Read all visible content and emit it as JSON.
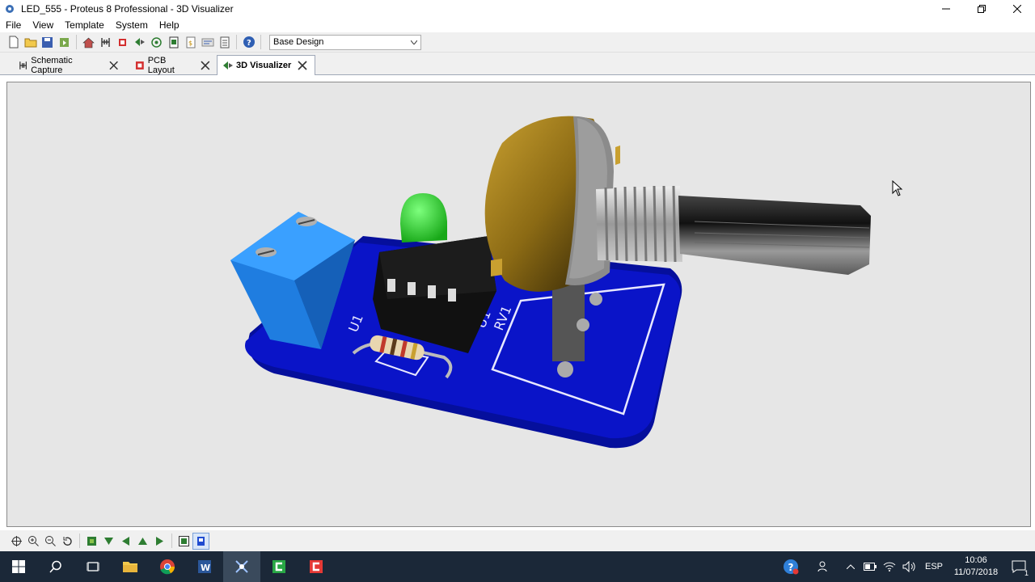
{
  "window": {
    "title": "LED_555 - Proteus 8 Professional - 3D Visualizer"
  },
  "menu": {
    "items": [
      {
        "label": "File"
      },
      {
        "label": "View"
      },
      {
        "label": "Template"
      },
      {
        "label": "System"
      },
      {
        "label": "Help"
      }
    ]
  },
  "toolbar": {
    "variant_value": "Base Design"
  },
  "tabs": [
    {
      "label": "Schematic Capture"
    },
    {
      "label": "PCB Layout"
    },
    {
      "label": "3D Visualizer"
    }
  ],
  "board": {
    "silkscreen": {
      "u1_a": "U1",
      "u1_b": "U1",
      "rv1": "RV1"
    },
    "colors": {
      "pcb": "#0a14c8",
      "terminal": "#1f7de0",
      "ic": "#111111",
      "led": "#2fd82f",
      "pot_body": "#8b6a14"
    }
  },
  "taskbar": {
    "language": "ESP",
    "time": "10:06",
    "date": "11/07/2018",
    "notification_count": "1"
  }
}
